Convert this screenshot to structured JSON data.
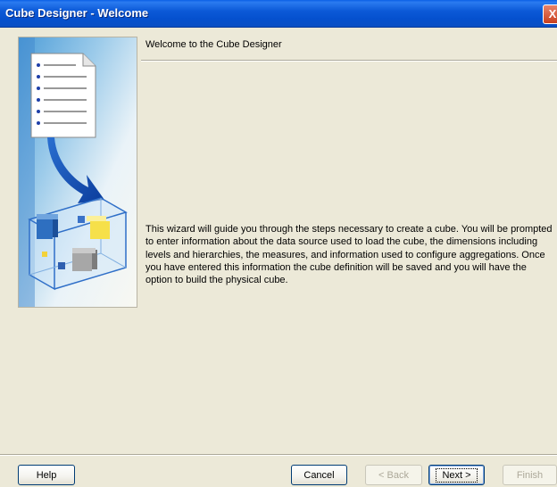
{
  "window": {
    "title": "Cube Designer - Welcome",
    "close_glyph": "X",
    "title_color": "#0550CE"
  },
  "side_illustration": {
    "icons": [
      "document-icon",
      "arrow-down-icon",
      "cube-icon"
    ]
  },
  "content": {
    "heading": "Welcome to the Cube Designer",
    "description": "This wizard will guide you through the steps necessary to create a cube.  You will be prompted to enter information about the data source used to load the cube, the dimensions including levels and hierarchies, the measures, and  information used to configure aggregations.  Once you have entered this information the cube definition will be saved and you will have the option to build the physical cube."
  },
  "footer": {
    "help_label": "Help",
    "cancel_label": "Cancel",
    "back_label": "< Back",
    "next_label": "Next >",
    "finish_label": "Finish"
  }
}
